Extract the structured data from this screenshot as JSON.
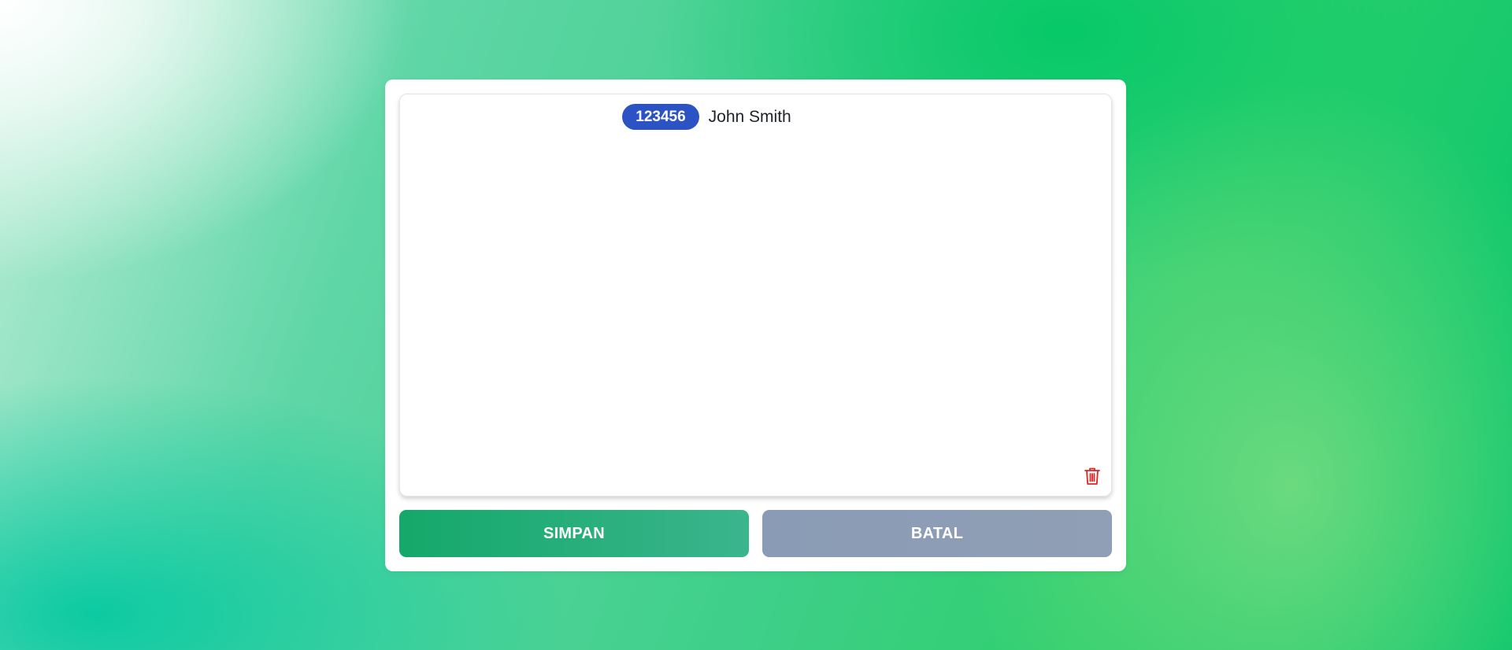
{
  "record": {
    "id_badge": "123456",
    "name": "John Smith"
  },
  "actions": {
    "save_label": "SIMPAN",
    "cancel_label": "BATAL"
  },
  "icons": {
    "delete": "trash-icon"
  },
  "colors": {
    "badge": "#2b53c4",
    "save": "#14a86a",
    "cancel": "#8a9bb5",
    "delete": "#e02424"
  }
}
